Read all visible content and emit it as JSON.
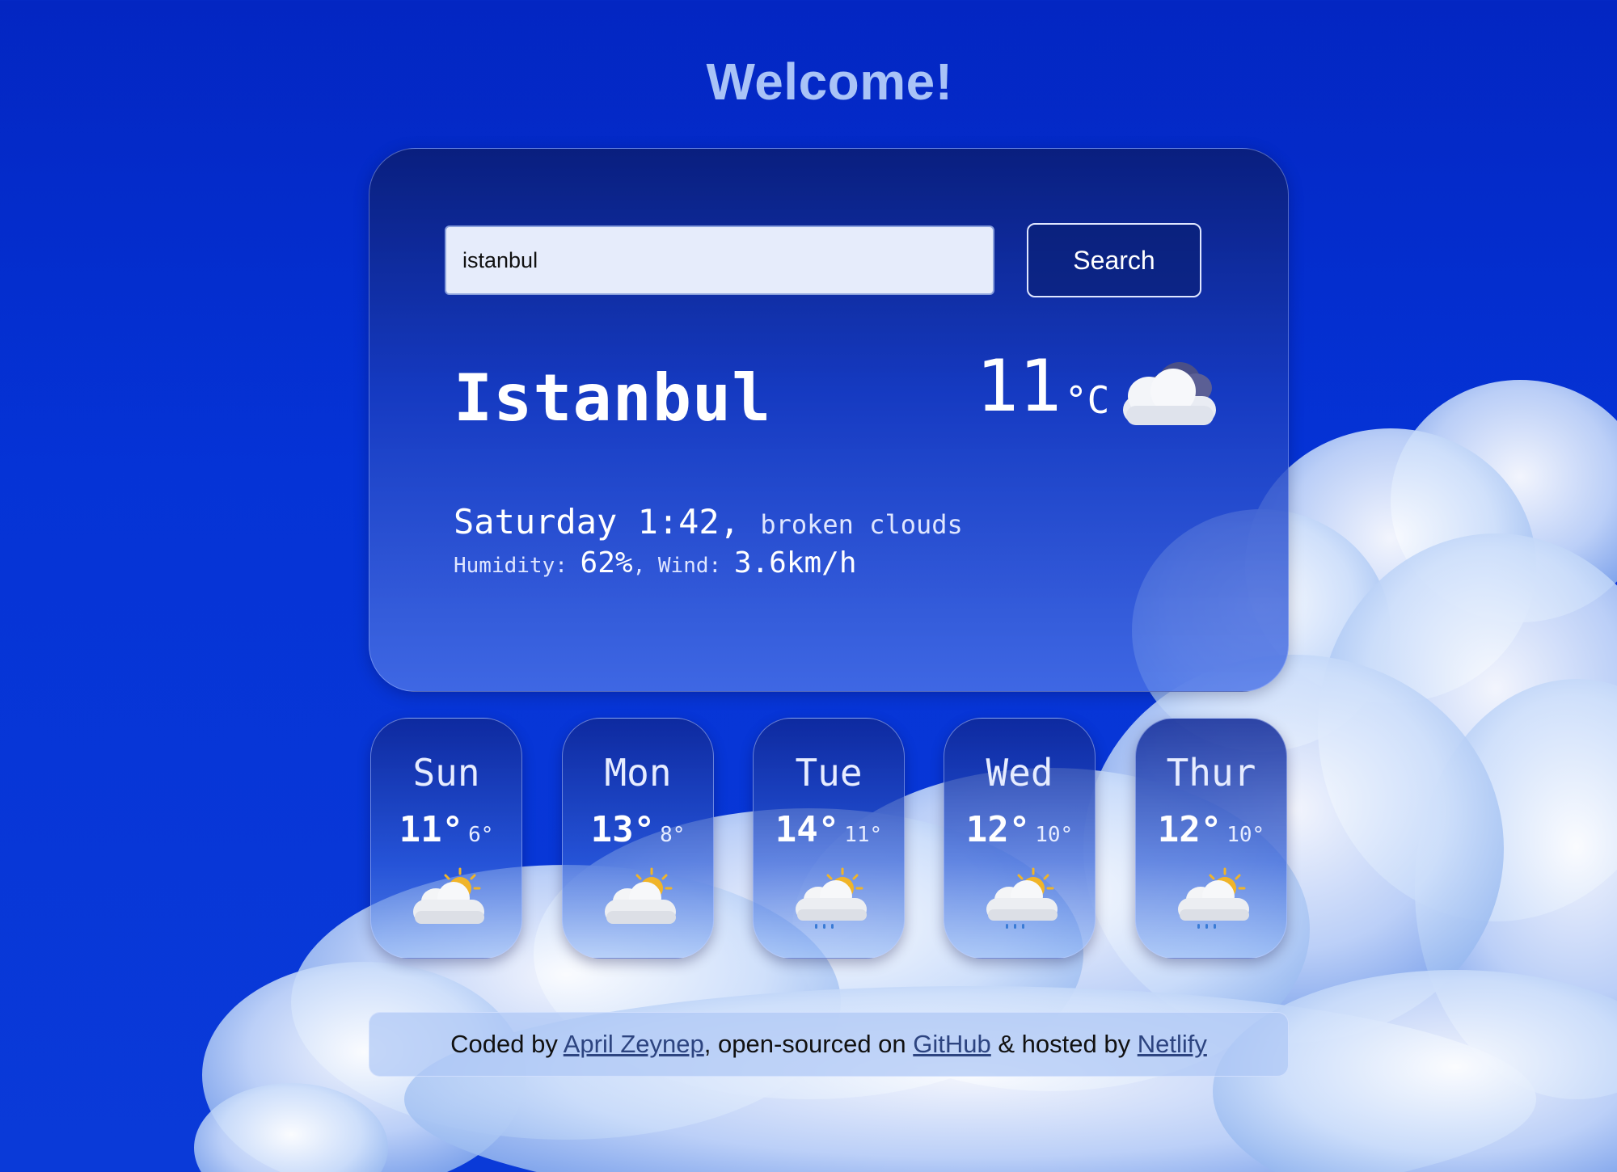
{
  "header": {
    "title": "Welcome!"
  },
  "search": {
    "value": "istanbul",
    "placeholder": "",
    "button_label": "Search"
  },
  "current": {
    "city": "Istanbul",
    "temperature": "11",
    "unit": "°C",
    "icon": "broken-clouds-icon",
    "day_time": "Saturday 1:42",
    "separator": ", ",
    "description": "broken clouds",
    "humidity_label": "Humidity: ",
    "humidity": "62%",
    "wind_label": ", Wind: ",
    "wind": "3.6km/h"
  },
  "forecast": [
    {
      "day": "Sun",
      "max": "11°",
      "min": "6°",
      "icon": "partly-cloudy-icon"
    },
    {
      "day": "Mon",
      "max": "13°",
      "min": "8°",
      "icon": "partly-cloudy-icon"
    },
    {
      "day": "Tue",
      "max": "14°",
      "min": "11°",
      "icon": "partly-cloudy-rain-icon"
    },
    {
      "day": "Wed",
      "max": "12°",
      "min": "10°",
      "icon": "partly-cloudy-rain-icon"
    },
    {
      "day": "Thur",
      "max": "12°",
      "min": "10°",
      "icon": "partly-cloudy-rain-icon"
    }
  ],
  "footer": {
    "text1": "Coded by ",
    "author": "April Zeynep",
    "text2": ", open-sourced on ",
    "github": "GitHub",
    "text3": " & hosted by ",
    "host": "Netlify"
  },
  "colors": {
    "background": "#0533d6",
    "title": "#a9c3f7",
    "text": "#ffffff",
    "link": "#2d4480"
  }
}
